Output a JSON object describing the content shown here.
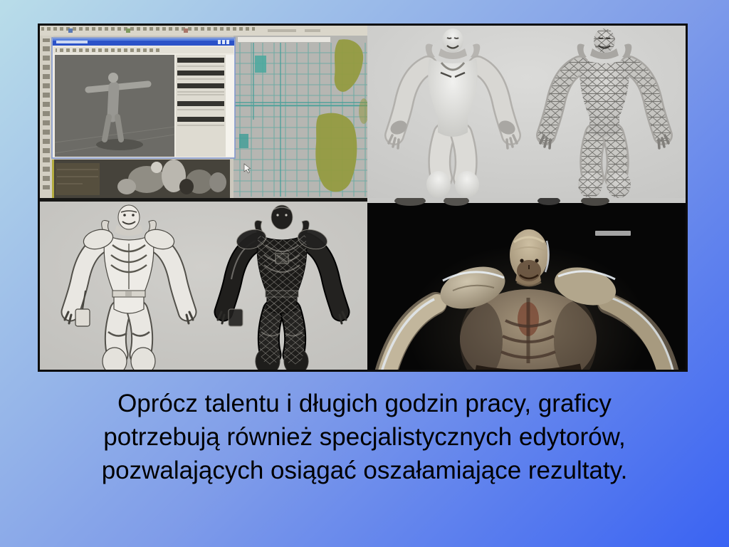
{
  "slide": {
    "caption": {
      "lines": [
        "Oprócz talentu i długich godzin pracy, graficy",
        "potrzebują również specjalistycznych edytorów,",
        "pozwalających osiągać oszałamiające rezultaty."
      ]
    }
  },
  "colors": {
    "background_gradient_start": "#b9dde9",
    "background_gradient_end": "#3a63f3",
    "collage_border": "#0d0d0d",
    "editor_chrome_beige": "#dad6ca",
    "window_titlebar_blue": "#2b52c8",
    "uv_wire_teal": "#43a49a",
    "uv_island_olive": "#949a3e",
    "viewport_gray": "#6c6b66",
    "model_backdrop_gray": "#dbdbd9",
    "render_background_black": "#060606",
    "caption_text": "#000000"
  }
}
